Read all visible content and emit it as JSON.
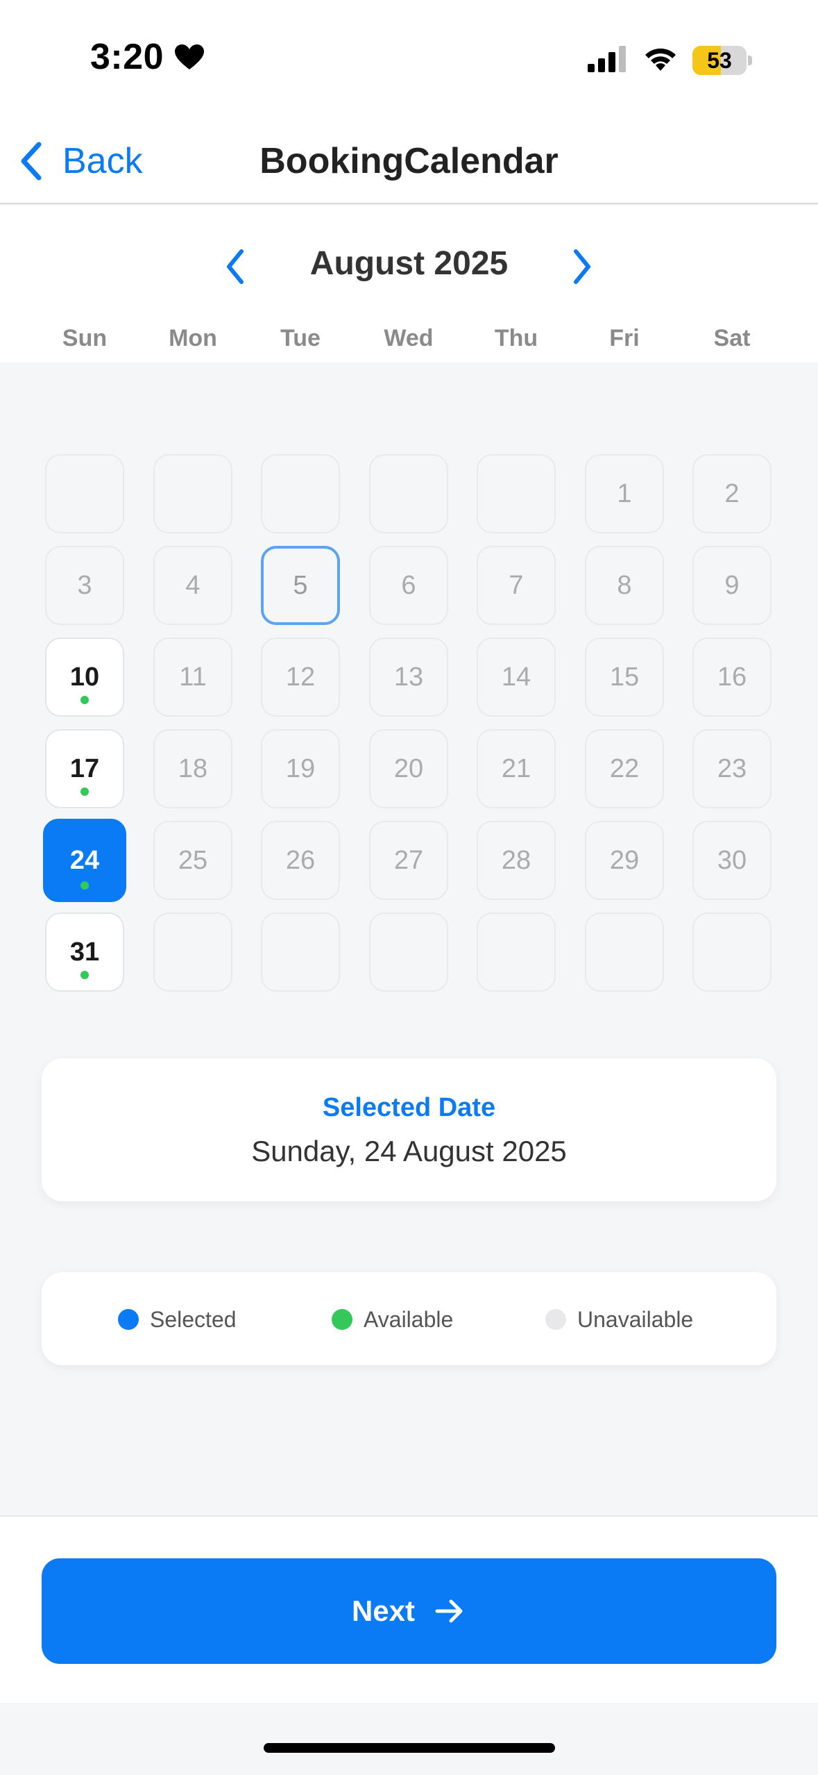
{
  "status_bar": {
    "time": "3:20",
    "battery_percent": "53",
    "battery_level": 0.53,
    "icons": [
      "heart-icon",
      "signal-icon",
      "wifi-icon",
      "battery-icon"
    ]
  },
  "nav": {
    "back_label": "Back",
    "title": "BookingCalendar"
  },
  "calendar": {
    "month_label": "August 2025",
    "weekdays": [
      "Sun",
      "Mon",
      "Tue",
      "Wed",
      "Thu",
      "Fri",
      "Sat"
    ],
    "weeks": [
      [
        "",
        "",
        "",
        "",
        "",
        "1",
        "2"
      ],
      [
        "3",
        "4",
        "5",
        "6",
        "7",
        "8",
        "9"
      ],
      [
        "10",
        "11",
        "12",
        "13",
        "14",
        "15",
        "16"
      ],
      [
        "17",
        "18",
        "19",
        "20",
        "21",
        "22",
        "23"
      ],
      [
        "24",
        "25",
        "26",
        "27",
        "28",
        "29",
        "30"
      ],
      [
        "31",
        "",
        "",
        "",
        "",
        "",
        ""
      ]
    ],
    "today": "5",
    "selected": "24",
    "available": [
      "10",
      "17",
      "24",
      "31"
    ]
  },
  "selected_card": {
    "title": "Selected Date",
    "value": "Sunday, 24 August 2025"
  },
  "legend": [
    {
      "label": "Selected",
      "color": "#0A7AF5"
    },
    {
      "label": "Available",
      "color": "#34C759"
    },
    {
      "label": "Unavailable",
      "color": "#E8E8EA"
    }
  ],
  "next_button": {
    "label": "Next"
  },
  "colors": {
    "accent": "#0A7AF5",
    "available": "#34C759"
  }
}
